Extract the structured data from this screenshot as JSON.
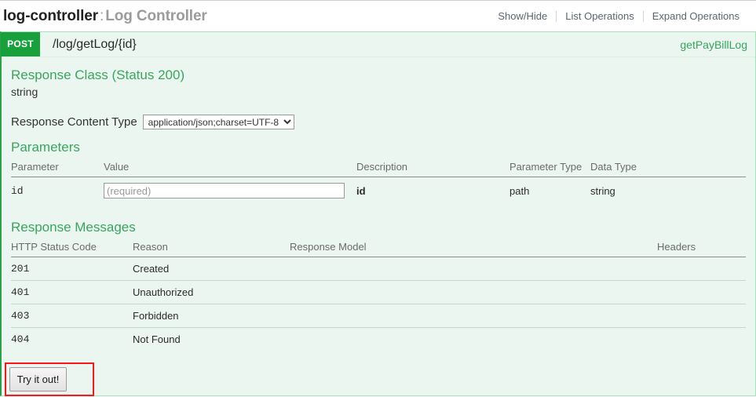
{
  "resource": {
    "name": "log-controller",
    "separator": ":",
    "description": "Log Controller"
  },
  "header_options": [
    {
      "label": "Show/Hide"
    },
    {
      "label": "List Operations"
    },
    {
      "label": "Expand Operations"
    }
  ],
  "operation": {
    "method": "POST",
    "path": "/log/getLog/{id}",
    "nickname": "getPayBillLog"
  },
  "response_class": {
    "title": "Response Class (Status 200)",
    "model_type": "string"
  },
  "content_type": {
    "label": "Response Content Type",
    "selected": "application/json;charset=UTF-8",
    "options": [
      "application/json;charset=UTF-8"
    ]
  },
  "parameters": {
    "title": "Parameters",
    "columns": [
      "Parameter",
      "Value",
      "Description",
      "Parameter Type",
      "Data Type"
    ],
    "rows": [
      {
        "parameter": "id",
        "value": "",
        "value_placeholder": "(required)",
        "description": "id",
        "parameter_type": "path",
        "data_type": "string"
      }
    ]
  },
  "response_messages": {
    "title": "Response Messages",
    "columns": [
      "HTTP Status Code",
      "Reason",
      "Response Model",
      "Headers"
    ],
    "rows": [
      {
        "code": "201",
        "reason": "Created",
        "model": "",
        "headers": ""
      },
      {
        "code": "401",
        "reason": "Unauthorized",
        "model": "",
        "headers": ""
      },
      {
        "code": "403",
        "reason": "Forbidden",
        "model": "",
        "headers": ""
      },
      {
        "code": "404",
        "reason": "Not Found",
        "model": "",
        "headers": ""
      }
    ]
  },
  "actions": {
    "try_it_out": "Try it out!"
  },
  "colors": {
    "method_post": "#18a03c",
    "heading_green": "#3aa55f",
    "panel_background": "#ecf6f0",
    "panel_border": "#a8e0bf",
    "annotation_red": "#f91818"
  }
}
